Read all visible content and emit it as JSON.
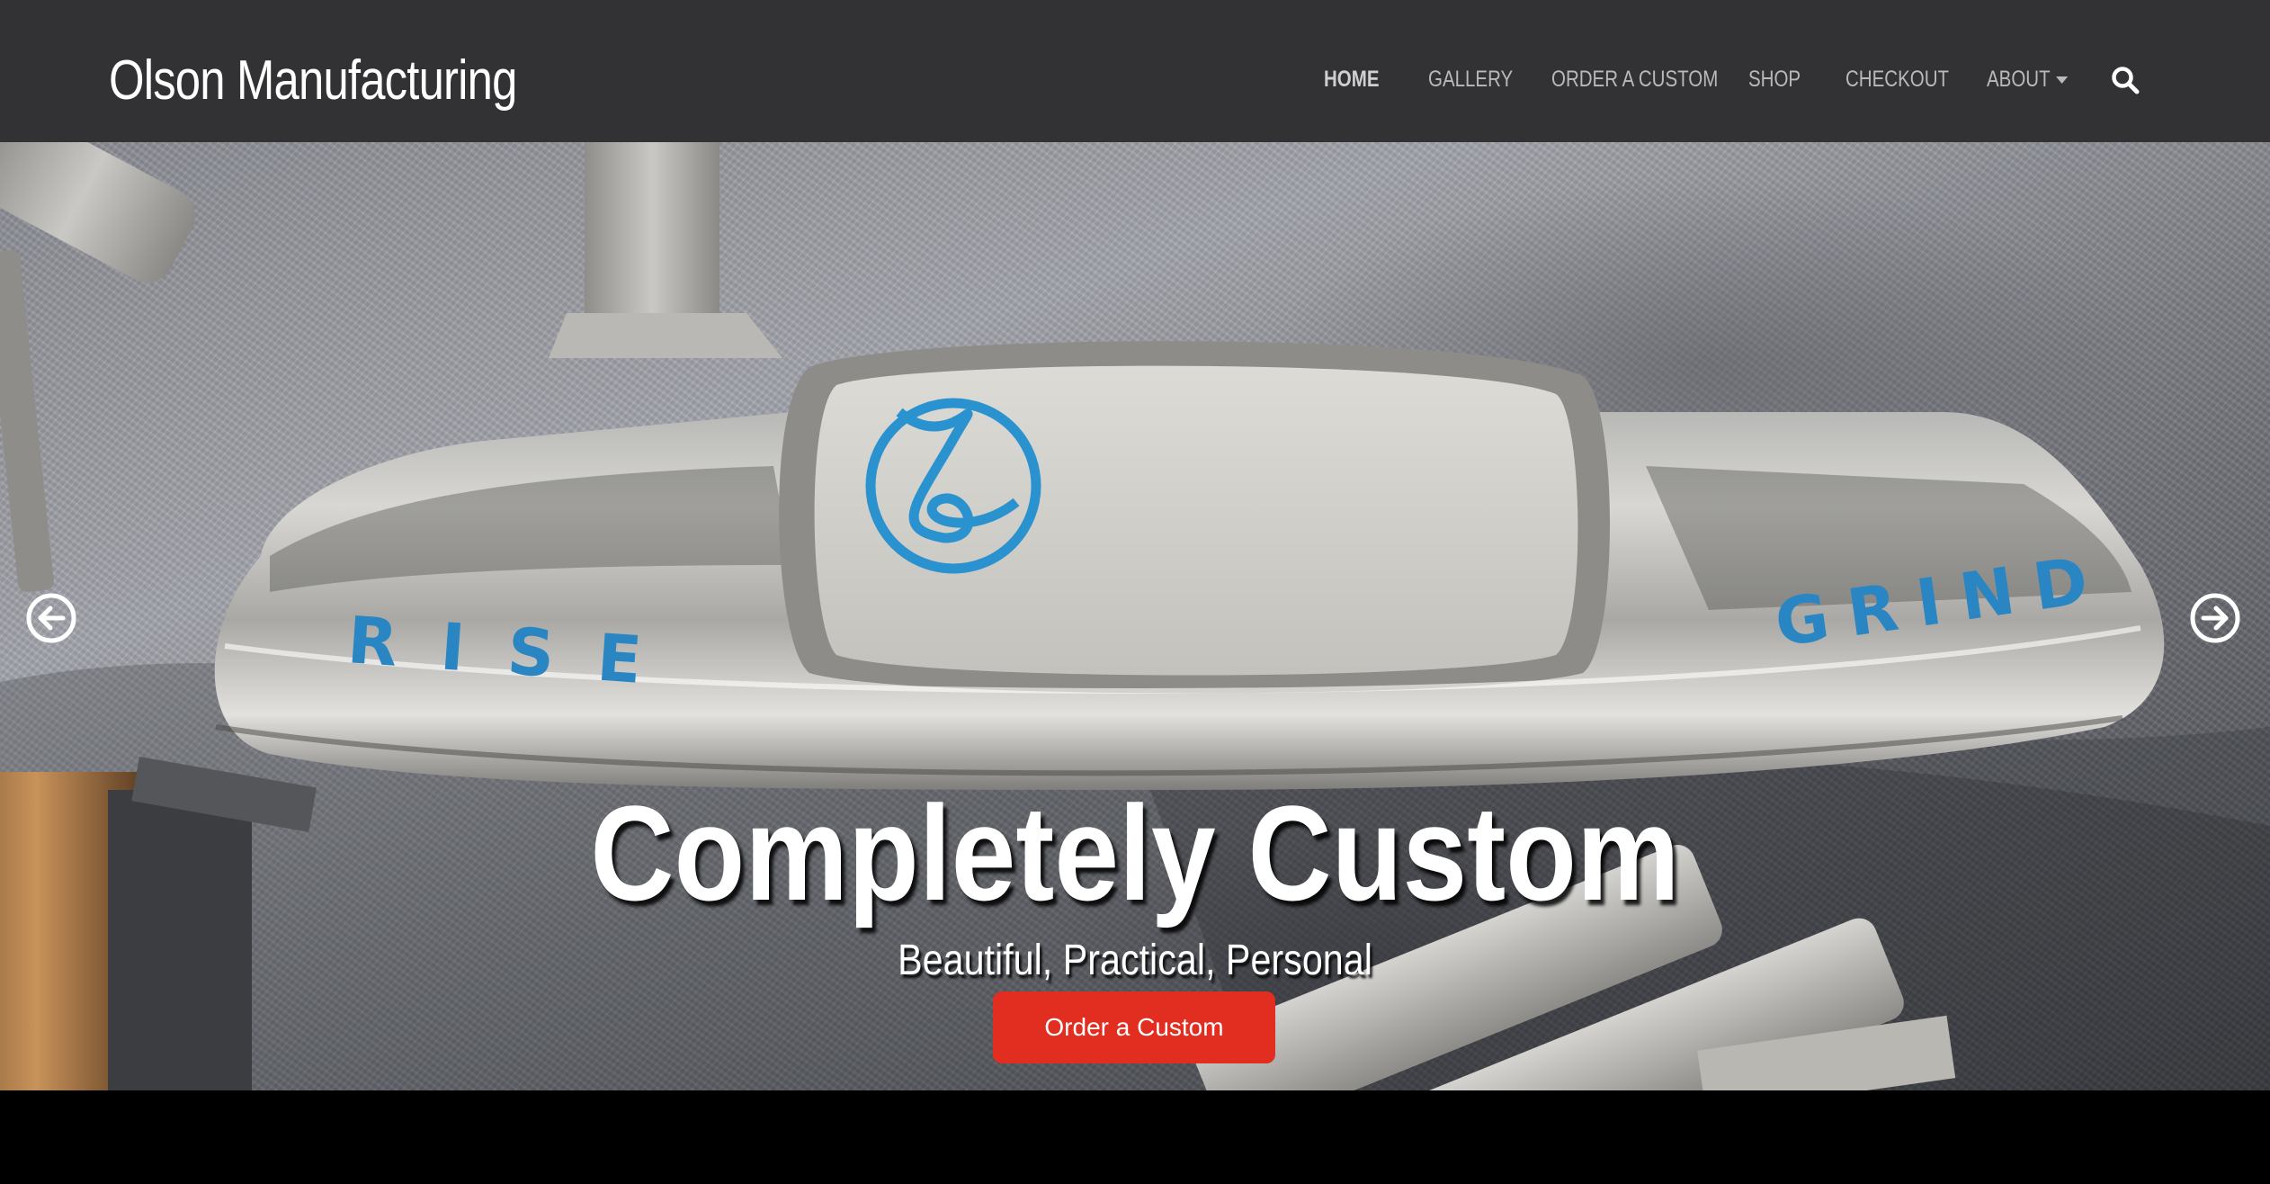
{
  "header": {
    "brand": "Olson Manufacturing",
    "nav": [
      {
        "label": "Home",
        "active": true
      },
      {
        "label": "Gallery"
      },
      {
        "label": "Order a Custom"
      },
      {
        "label": "Shop"
      },
      {
        "label": "Checkout"
      },
      {
        "label": "About",
        "has_dropdown": true
      }
    ],
    "search_icon": "search-icon"
  },
  "hero": {
    "image_engraving_left": "RISE",
    "image_engraving_right": "GRIND",
    "title": "Completely Custom",
    "subtitle": "Beautiful, Practical, Personal",
    "cta_label": "Order a Custom",
    "prev_icon": "arrow-left-circle-icon",
    "next_icon": "arrow-right-circle-icon"
  },
  "colors": {
    "navbar_bg": "#323234",
    "cta_bg": "#e22d21",
    "logo_blue": "#2a93cf"
  }
}
